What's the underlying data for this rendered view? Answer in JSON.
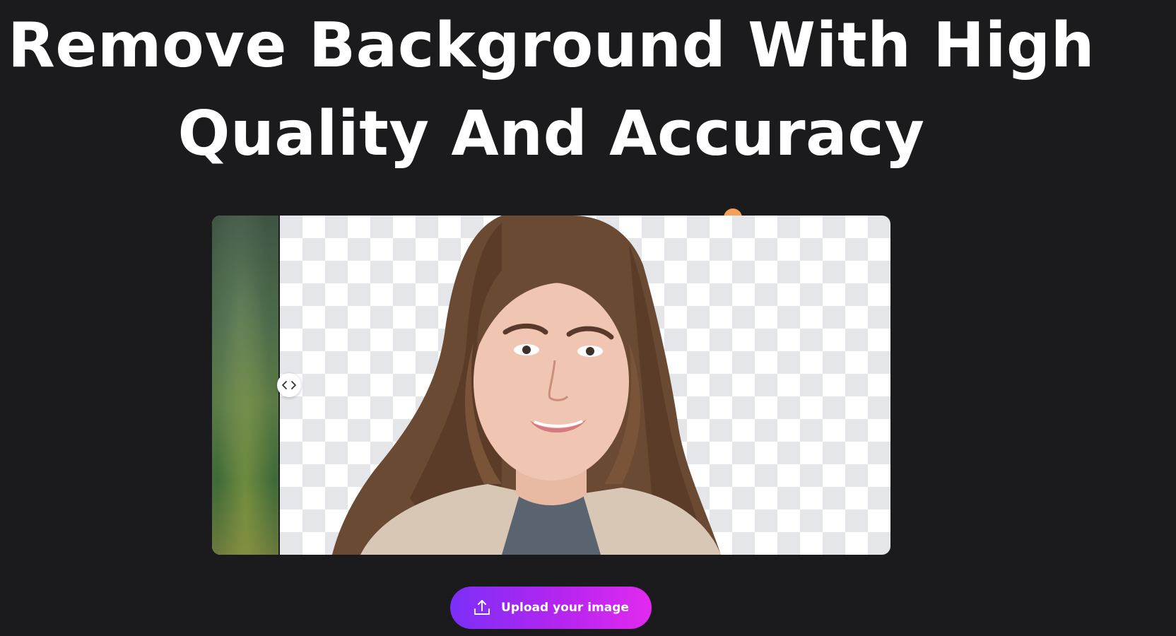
{
  "hero": {
    "title_line1": "Remove Background With High",
    "title_line2": "Quality And Accuracy"
  },
  "comparison": {
    "before_fraction": 0.1,
    "handle_icon": "chevron-left-right-icon"
  },
  "upload": {
    "label": "Upload your image",
    "icon": "upload-icon"
  },
  "colors": {
    "background": "#1b1a1d",
    "button_gradient_start": "#7b2ff7",
    "button_gradient_end": "#e22aef",
    "accent_dot": "#f4a05a",
    "checker": "#e5e6ea"
  }
}
